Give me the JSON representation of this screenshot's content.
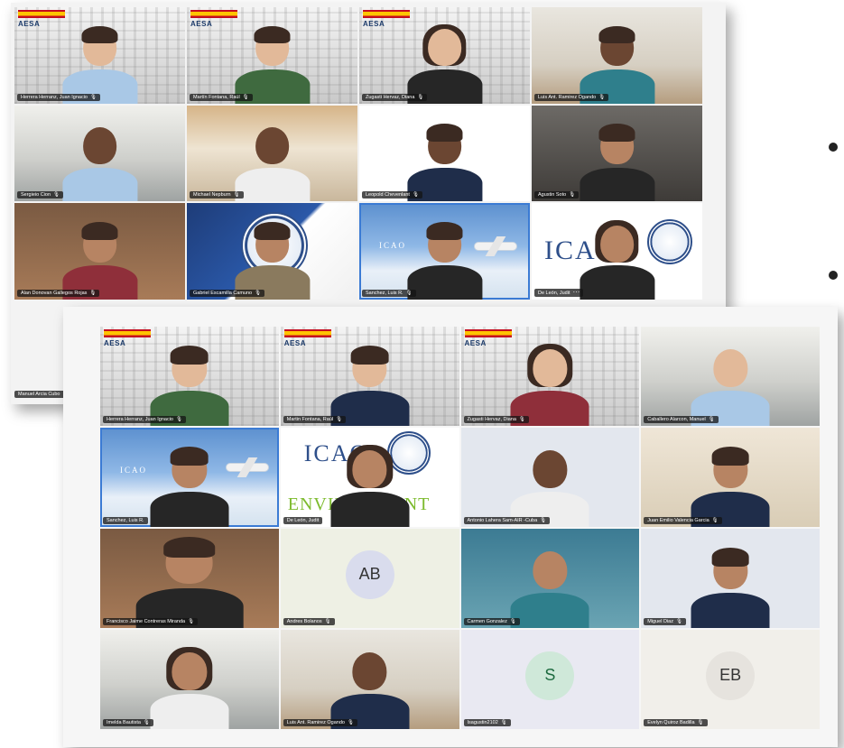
{
  "screenshot_back": {
    "tiles": [
      {
        "name": "Herrera Herranz, Juan Ignacio",
        "bg": "building",
        "logo": "AESA"
      },
      {
        "name": "Martín Fontana, Raúl",
        "bg": "building",
        "logo": "AESA"
      },
      {
        "name": "Zugasti Hervaz, Diana",
        "bg": "building",
        "logo": "AESA"
      },
      {
        "name": "Luis Ant. Ramirez Ogando",
        "bg": "room"
      },
      {
        "name": "Sergieio Cion",
        "bg": "office"
      },
      {
        "name": "Michael Nepburn",
        "bg": "wood"
      },
      {
        "name": "Leopold Chevenlant",
        "bg": "white"
      },
      {
        "name": "Agustin Soto",
        "bg": "dark"
      },
      {
        "name": "Alan Donovan Gallegos Rojas",
        "bg": "brick"
      },
      {
        "name": "Gabriel Escamilla Camuno",
        "bg": "blue"
      },
      {
        "name": "Sanchez, Luis R.",
        "bg": "sky",
        "brand": "ICAO"
      },
      {
        "name": "De León, Judit",
        "bg": "white",
        "brand": "ICAO",
        "more": "···"
      }
    ],
    "strip_name": "Manuel Arcia Cubo"
  },
  "screenshot_front": {
    "tiles": [
      {
        "name": "Herrera Herranz, Juan Ignacio",
        "bg": "building",
        "logo": "AESA"
      },
      {
        "name": "Martin Fontana, Raúl",
        "bg": "building",
        "logo": "AESA"
      },
      {
        "name": "Zugasti Hervaz, Diana",
        "bg": "building",
        "logo": "AESA"
      },
      {
        "name": "Caballero Alarcon, Manuel",
        "bg": "office"
      },
      {
        "name": "Sanchez, Luis R.",
        "bg": "sky",
        "brand": "ICAO"
      },
      {
        "name": "De León, Judit",
        "bg": "white",
        "brand": "ICAO",
        "extra": "ENVIRONMENT"
      },
      {
        "name": "Antonio Lahera Sam-AIR -Cuba",
        "bg": "plain"
      },
      {
        "name": "Juan Emilio Valencia Garcia",
        "bg": "warm"
      },
      {
        "name": "Francisco Jaime Contreras Miranda",
        "bg": "brick"
      },
      {
        "name": "Andres Bolanos",
        "bg": "mint",
        "avatar": "AB"
      },
      {
        "name": "Carmen Gonzalez",
        "bg": "teal"
      },
      {
        "name": "Miguel Diaz",
        "bg": "plain"
      },
      {
        "name": "Imelda Bautista",
        "bg": "office"
      },
      {
        "name": "Luis Ant. Ramirez Ogando",
        "bg": "room"
      },
      {
        "name": "Isagustin2102",
        "bg": "plain",
        "avatar": "S"
      },
      {
        "name": "Evelyn Quiroz Badilla",
        "bg": "warm",
        "avatar": "EB"
      }
    ]
  },
  "icons": {
    "mic": "🎙",
    "video": "📹"
  }
}
